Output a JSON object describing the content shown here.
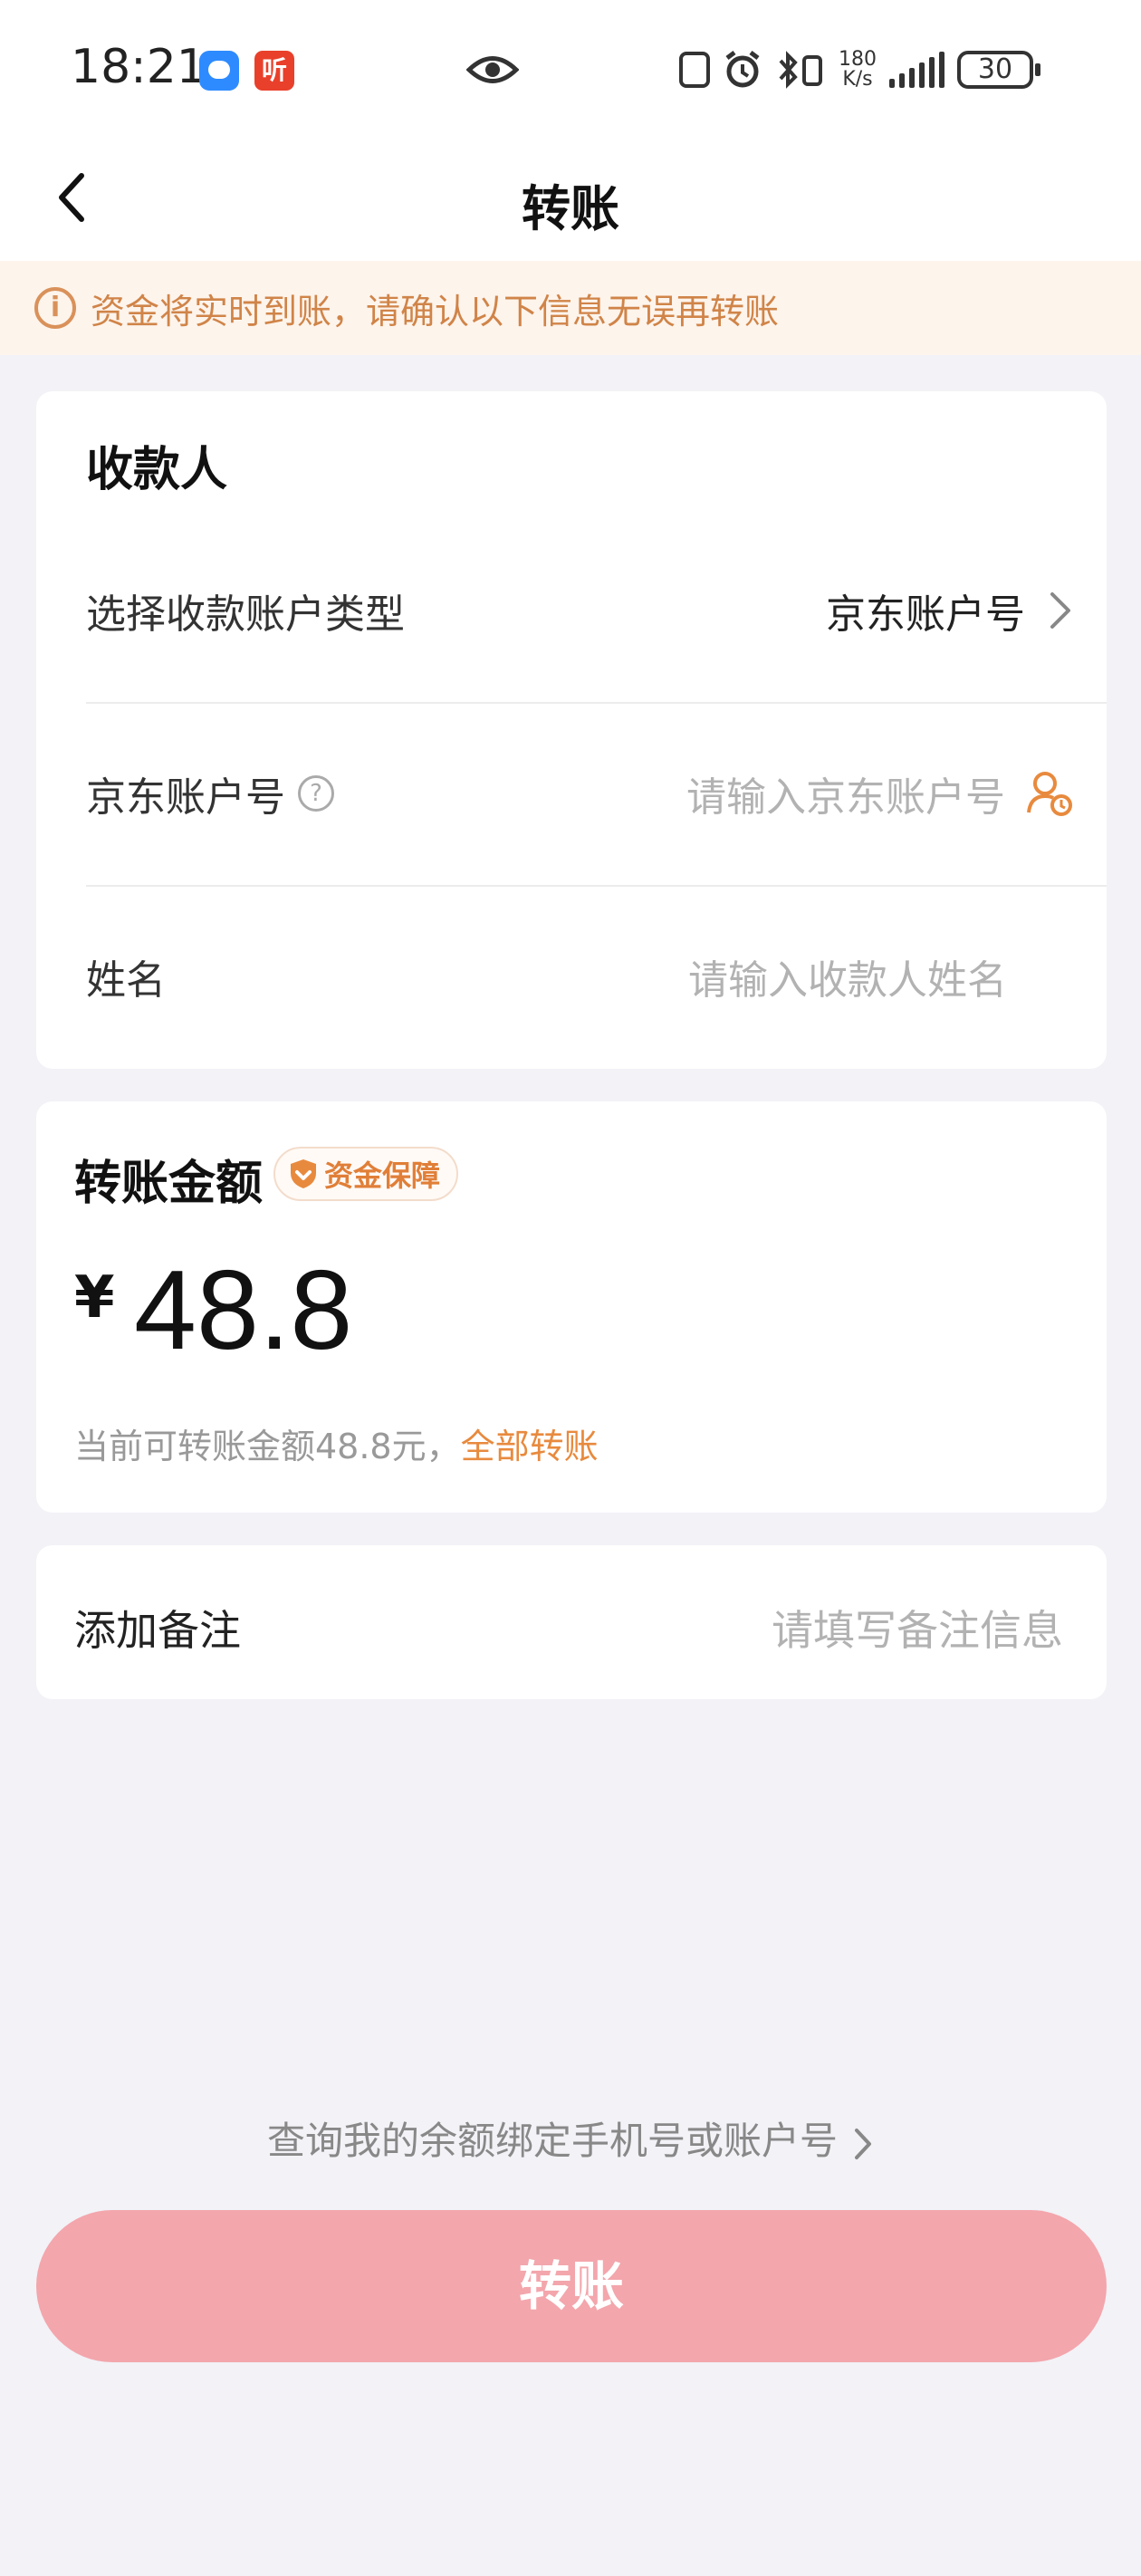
{
  "status_bar": {
    "time": "18:21",
    "app2_glyph": "听",
    "net_speed_value": "180",
    "net_speed_unit": "K/s",
    "battery": "30",
    "icons": [
      "chat-app-icon",
      "listen-app-icon",
      "eye-icon",
      "nfc-icon",
      "alarm-icon",
      "bluetooth-icon",
      "signal-icon",
      "battery-icon"
    ]
  },
  "nav": {
    "title": "转账",
    "back_icon": "chevron-left-icon"
  },
  "notice": {
    "text": "资金将实时到账，请确认以下信息无误再转账",
    "icon": "info-icon",
    "color": "#d08448"
  },
  "payee": {
    "title": "收款人",
    "account_type_label": "选择收款账户类型",
    "account_type_value": "京东账户号",
    "account_label": "京东账户号",
    "account_placeholder": "请输入京东账户号",
    "name_label": "姓名",
    "name_placeholder": "请输入收款人姓名"
  },
  "amount": {
    "title": "转账金额",
    "badge": "资金保障",
    "currency": "¥",
    "value": "48.8",
    "available_text": "当前可转账金额48.8元，",
    "transfer_all": "全部转账"
  },
  "note": {
    "label": "添加备注",
    "placeholder": "请填写备注信息"
  },
  "footer": {
    "query_link": "查询我的余额绑定手机号或账户号",
    "submit": "转账",
    "submit_color": "#f3a6ac",
    "accent_color": "#e88a3e"
  }
}
